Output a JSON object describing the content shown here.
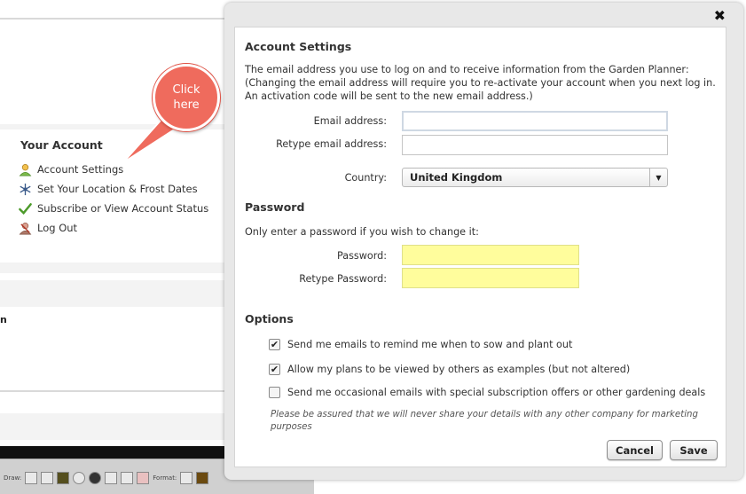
{
  "background": {
    "account_heading": "Your Account",
    "menu": [
      {
        "label": "Account Settings",
        "icon": "user-icon"
      },
      {
        "label": "Set Your Location & Frost Dates",
        "icon": "snowflake-icon"
      },
      {
        "label": "Subscribe or View Account Status",
        "icon": "checkmark-icon"
      },
      {
        "label": "Log Out",
        "icon": "logout-user-icon"
      }
    ],
    "fragment_letter": "n",
    "editor_labels": {
      "draw": "Draw:",
      "format": "Format:"
    }
  },
  "callout": {
    "line1": "Click",
    "line2": "here",
    "color": "#ef6b5d"
  },
  "modal": {
    "close_glyph": "✖",
    "account": {
      "title": "Account Settings",
      "description_1": "The email address you use to log on and to receive information from the Garden Planner:",
      "description_2": "(Changing the email address will require you to re-activate your account when you next log in.",
      "description_3": "An activation code will be sent to the new email address.)",
      "email_label": "Email address:",
      "email_value": "",
      "retype_email_label": "Retype email address:",
      "retype_email_value": "",
      "country_label": "Country:",
      "country_value": "United Kingdom"
    },
    "password": {
      "title": "Password",
      "description": "Only enter a password if you wish to change it:",
      "password_label": "Password:",
      "retype_password_label": "Retype Password:",
      "highlight_color": "#fffd9c"
    },
    "options": {
      "title": "Options",
      "items": [
        {
          "label": "Send me emails to remind me when to sow and plant out",
          "checked": true,
          "mark": "✔"
        },
        {
          "label": "Allow my plans to be viewed by others as examples (but not altered)",
          "checked": true,
          "mark": "✔"
        },
        {
          "label": "Send me occasional emails with special subscription offers or other gardening deals",
          "checked": false,
          "mark": ""
        }
      ],
      "note_1": "Please be assured that we will never share your details with any other company for marketing",
      "note_2": "purposes"
    },
    "buttons": {
      "cancel": "Cancel",
      "save": "Save"
    }
  }
}
